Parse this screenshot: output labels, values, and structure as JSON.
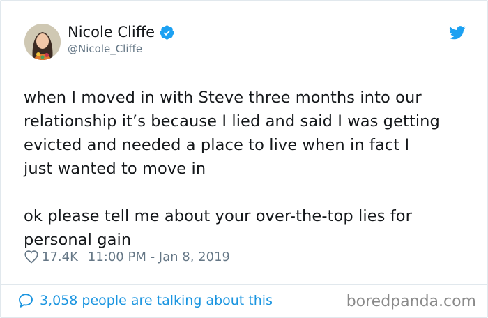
{
  "tweet": {
    "author": {
      "display_name": "Nicole Cliffe",
      "handle": "@Nicole_Cliffe",
      "verified": true
    },
    "text": "when I moved in with Steve three months into our\nrelationship it’s because I lied and said I was getting\nevicted and needed a place to live when in fact I\njust wanted to move in\n\nok please tell me about your over-the-top lies for\npersonal gain",
    "likes": "17.4K",
    "timestamp": "11:00 PM - Jan 8, 2019",
    "conversation": "3,058 people are talking about this"
  },
  "icons": {
    "verified": "verified-badge-icon",
    "bird": "twitter-bird-icon",
    "like": "heart-icon",
    "reply": "speech-bubble-icon"
  },
  "colors": {
    "accent": "#1da1f2",
    "link": "#1b95e0",
    "muted": "#657786",
    "text": "#14171a"
  },
  "watermark": "boredpanda.com"
}
